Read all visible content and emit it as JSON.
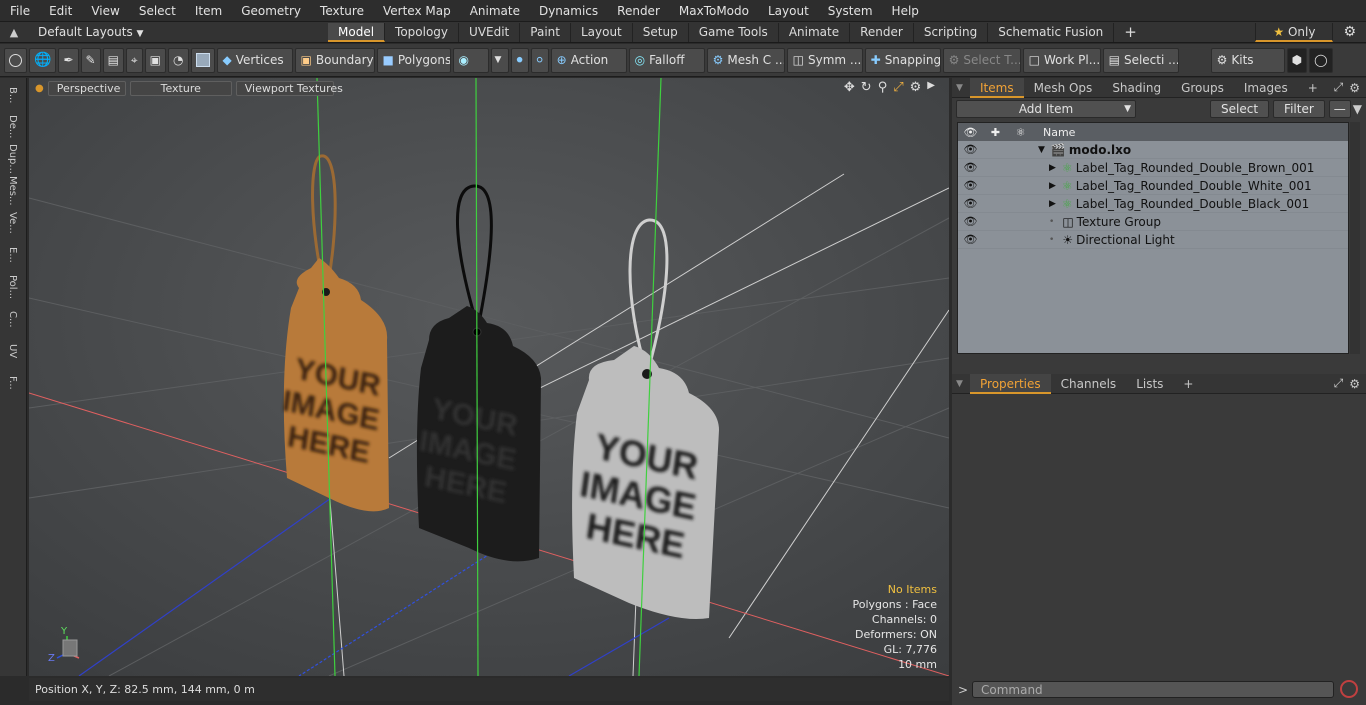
{
  "menu": [
    "File",
    "Edit",
    "View",
    "Select",
    "Item",
    "Geometry",
    "Texture",
    "Vertex Map",
    "Animate",
    "Dynamics",
    "Render",
    "MaxToModo",
    "Layout",
    "System",
    "Help"
  ],
  "layout_bar": {
    "layouts_label": "Default Layouts",
    "tabs": [
      "Model",
      "Topology",
      "UVEdit",
      "Paint",
      "Layout",
      "Setup",
      "Game Tools",
      "Animate",
      "Render",
      "Scripting",
      "Schematic Fusion"
    ],
    "active_tab": "Model",
    "plus": "+",
    "only_label": "Only",
    "star": "★"
  },
  "toolbar": {
    "vertices": "Vertices",
    "boundary": "Boundary",
    "polygons": "Polygons",
    "action": "Action",
    "falloff": "Falloff",
    "mesh": "Mesh C ...",
    "symm": "Symm ...",
    "snapping": "Snapping",
    "select_t": "Select T...",
    "work_pl": "Work Pl...",
    "selecti": "Selecti ...",
    "kits": "Kits"
  },
  "left_strip": [
    "B...",
    "De...",
    "Dup...",
    "Mes...",
    "Ve...",
    "E...",
    "Pol...",
    "C...",
    "UV",
    "F..."
  ],
  "viewport": {
    "perspective": "Perspective",
    "texture": "Texture",
    "viewport_textures": "Viewport Textures",
    "tag_text_lines": [
      "YOUR",
      "IMAGE",
      "HERE"
    ],
    "hud": {
      "no_items": "No Items",
      "polygons": "Polygons : Face",
      "channels": "Channels: 0",
      "deformers": "Deformers: ON",
      "gl": "GL: 7,776",
      "scale": "10 mm"
    },
    "axis_y": "Y",
    "axis_z": "Z"
  },
  "status": "Position X, Y, Z:   82.5 mm, 144 mm, 0 m",
  "items_panel": {
    "tabs": [
      "Items",
      "Mesh Ops",
      "Shading",
      "Groups",
      "Images"
    ],
    "active": "Items",
    "add_item": "Add Item",
    "select": "Select",
    "filter": "Filter",
    "name_header": "Name",
    "tree": [
      {
        "label": "modo.lxo",
        "bold": true,
        "indent": 0
      },
      {
        "label": "Label_Tag_Rounded_Double_Brown_001",
        "indent": 1
      },
      {
        "label": "Label_Tag_Rounded_Double_White_001",
        "indent": 1
      },
      {
        "label": "Label_Tag_Rounded_Double_Black_001",
        "indent": 1
      },
      {
        "label": "Texture Group",
        "indent": 1
      },
      {
        "label": "Directional Light",
        "indent": 1
      }
    ]
  },
  "properties_panel": {
    "tabs": [
      "Properties",
      "Channels",
      "Lists"
    ],
    "active": "Properties"
  },
  "command": {
    "prompt": ">",
    "placeholder": "Command"
  },
  "colors": {
    "accent": "#d8962b",
    "brown_tag": "#b87a3a",
    "black_tag": "#1c1c1c",
    "white_tag": "#bdbdbd",
    "tree_bg": "#8b9198"
  }
}
